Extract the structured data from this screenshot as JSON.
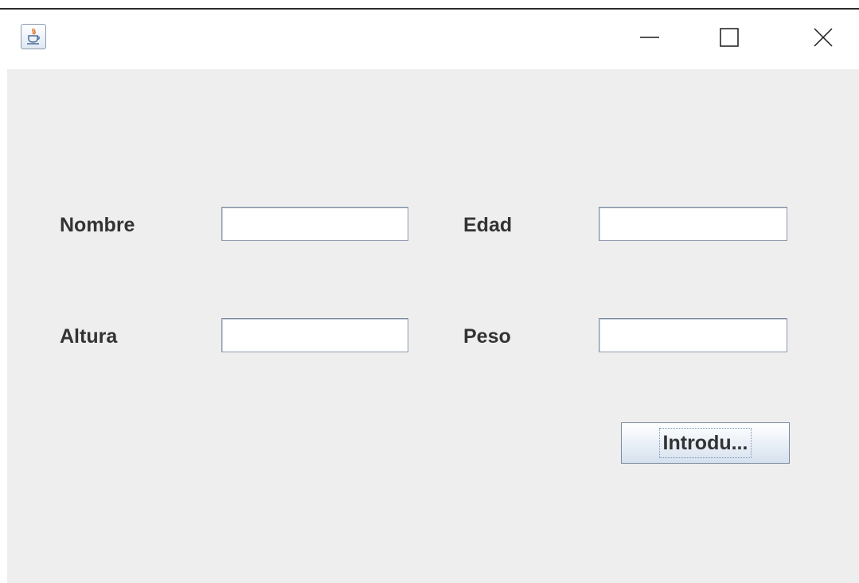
{
  "window": {
    "app_icon": "java-cup-icon",
    "controls": {
      "minimize_icon": "minimize-icon",
      "maximize_icon": "maximize-icon",
      "close_icon": "close-icon"
    }
  },
  "form": {
    "nombre": {
      "label": "Nombre",
      "value": ""
    },
    "edad": {
      "label": "Edad",
      "value": ""
    },
    "altura": {
      "label": "Altura",
      "value": ""
    },
    "peso": {
      "label": "Peso",
      "value": ""
    },
    "submit_label": "Introdu..."
  },
  "colors": {
    "panel_background": "#eeeeee",
    "label_text": "#333333",
    "field_border": "#8e9aae"
  }
}
